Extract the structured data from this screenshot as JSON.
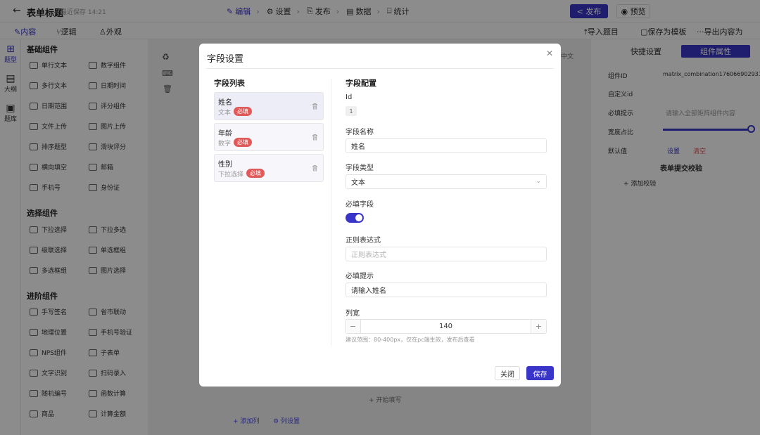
{
  "topbar": {
    "back_icon": "←",
    "form_title": "表单标题",
    "saved_text": "最近保存 14:21",
    "steps": [
      {
        "icon": "✎",
        "label": "编辑"
      },
      {
        "icon": "⚙",
        "label": "设置"
      },
      {
        "icon": "⎘",
        "label": "发布"
      },
      {
        "icon": "▤",
        "label": "数据"
      },
      {
        "icon": "⌸",
        "label": "统计"
      }
    ],
    "publish_label": "发布",
    "preview_label": "预览"
  },
  "subbar": {
    "tabs": [
      "内容",
      "逻辑",
      "外观"
    ],
    "actions": [
      "导入题目",
      "保存为模板",
      "导出内容为"
    ]
  },
  "rail": [
    "题型",
    "大纲",
    "题库"
  ],
  "palette": {
    "groups": [
      {
        "title": "基础组件",
        "items": [
          "单行文本",
          "数字组件",
          "多行文本",
          "日期时间",
          "日期范围",
          "评分组件",
          "文件上传",
          "图片上传",
          "排序题型",
          "滑块评分",
          "横向填空",
          "邮箱",
          "手机号",
          "身份证"
        ]
      },
      {
        "title": "选择组件",
        "items": [
          "下拉选择",
          "下拉多选",
          "级联选择",
          "单选框组",
          "多选框组",
          "图片选择"
        ]
      },
      {
        "title": "进阶组件",
        "items": [
          "手写签名",
          "省市联动",
          "地理位置",
          "手机号验证",
          "NPS组件",
          "子表单",
          "文字识别",
          "扫码录入",
          "随机编号",
          "函数计算",
          "商品",
          "计算金额"
        ]
      }
    ]
  },
  "rightpanel": {
    "tabs": [
      "快捷设置",
      "组件属性"
    ],
    "lang": "中文",
    "component_id_label": "组件ID",
    "component_id_value": "matrix_combination1760669029311",
    "custom_id_label": "自定义id",
    "required_hint_label": "必填提示",
    "required_hint_placeholder": "请输入全部矩阵组件内容",
    "width_label": "宽度占比",
    "default_label": "默认值",
    "set_label": "设置",
    "clear_label": "清空",
    "validate_title": "表单提交校验",
    "add_validate": "添加校验"
  },
  "modal": {
    "title": "字段设置",
    "close_icon": "✕",
    "list_title": "字段列表",
    "config_title": "字段配置",
    "fields": [
      {
        "name": "姓名",
        "type": "文本",
        "badge": "必填"
      },
      {
        "name": "年龄",
        "type": "数字",
        "badge": "必填"
      },
      {
        "name": "性别",
        "type": "下拉选择",
        "badge": "必填"
      }
    ],
    "config": {
      "id_label": "Id",
      "id_value": "1",
      "name_label": "字段名称",
      "name_value": "姓名",
      "type_label": "字段类型",
      "type_value": "文本",
      "required_label": "必填字段",
      "required_on": true,
      "regex_label": "正则表达式",
      "regex_placeholder": "正则表达式",
      "hint_label": "必填提示",
      "hint_value": "请输入姓名",
      "width_label": "列宽",
      "width_value": "140",
      "width_hint": "建议范围：80-400px，仅在pc端生效，发布后查看"
    },
    "close_label": "关闭",
    "save_label": "保存"
  },
  "canvas": {
    "start_fill": "开始填写",
    "add_column": "添加列",
    "column_settings": "列设置"
  },
  "colors": {
    "accent": "#3a35c9",
    "badge": "#e15a5a"
  }
}
